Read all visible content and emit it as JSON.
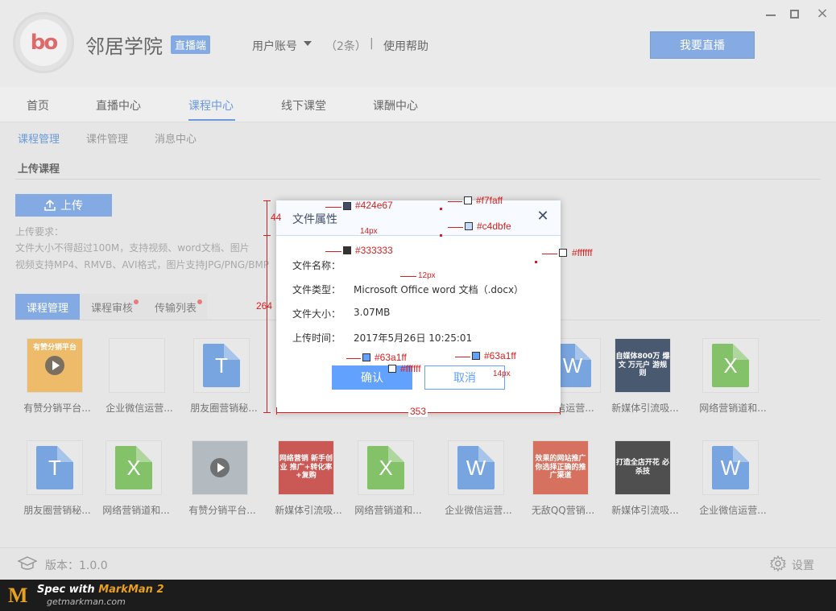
{
  "header": {
    "logo_text": "bo",
    "app_name": "邻居学院",
    "app_badge": "直播端",
    "account_label": "用户账号",
    "message_count": "（2条）",
    "separator": "|",
    "help_label": "使用帮助",
    "live_button": "我要直播",
    "window_controls": [
      "minimize-icon",
      "maximize-icon",
      "close-icon"
    ],
    "close_glyph": "×"
  },
  "main_tabs": [
    "首页",
    "直播中心",
    "课程中心",
    "线下课堂",
    "课酬中心"
  ],
  "main_tabs_active": "课程中心",
  "sub_tabs": [
    "课程管理",
    "课件管理",
    "消息中心"
  ],
  "sub_tabs_active": "课程管理",
  "section_title": "上传课程",
  "upload_button": "上传",
  "requirements": {
    "heading": "上传要求：",
    "line1": "文件大小不得超过100M，支持视频、word文档、图片",
    "line2": "视频支持MP4、RMVB、AVI格式，图片支持JPG/PNG/BMP"
  },
  "course_tabs": [
    "课程管理",
    "课程审核",
    "传输列表"
  ],
  "files_row1": [
    {
      "name": "有赞分销平台...",
      "kind": "video",
      "thumb_text": "有赞分销平台"
    },
    {
      "name": "企业微信运营...",
      "kind": "blank",
      "thumb_text": ""
    },
    {
      "name": "朋友圈营销秘...",
      "kind": "word",
      "thumb_text": "T"
    },
    {
      "name": "",
      "kind": "hidden",
      "thumb_text": ""
    },
    {
      "name": "",
      "kind": "hidden",
      "thumb_text": ""
    },
    {
      "name": "",
      "kind": "hidden",
      "thumb_text": ""
    },
    {
      "name": "信运营...",
      "kind": "word",
      "thumb_text": "W"
    },
    {
      "name": "新媒体引流吸...",
      "kind": "image-dark",
      "thumb_text": "自媒体800万 爆文 万元户 游规则"
    },
    {
      "name": "网络营销道和...",
      "kind": "excel",
      "thumb_text": "X"
    }
  ],
  "files_row2": [
    {
      "name": "朋友圈营销秘...",
      "kind": "word",
      "thumb_text": "T"
    },
    {
      "name": "网络营销道和...",
      "kind": "excel",
      "thumb_text": "X"
    },
    {
      "name": "有赞分销平台...",
      "kind": "video-gray",
      "thumb_text": ""
    },
    {
      "name": "新媒体引流吸...",
      "kind": "image-red",
      "thumb_text": "网络营销 新手创业 推广+转化率+复购"
    },
    {
      "name": "网络营销道和...",
      "kind": "excel",
      "thumb_text": "X"
    },
    {
      "name": "企业微信运营...",
      "kind": "word",
      "thumb_text": "W"
    },
    {
      "name": "无敌QQ营销...",
      "kind": "image-red2",
      "thumb_text": "效果的网站推广 你选择正确的推广渠道"
    },
    {
      "name": "新媒体引流吸...",
      "kind": "image-black",
      "thumb_text": "打造全店开花 必杀技"
    },
    {
      "name": "企业微信运营...",
      "kind": "word",
      "thumb_text": "W"
    }
  ],
  "footer": {
    "version": "版本：1.0.0",
    "settings": "设置"
  },
  "modal": {
    "title": "文件属性",
    "close_glyph": "✕",
    "fields": [
      {
        "label": "文件名称：",
        "value": ""
      },
      {
        "label": "文件类型：",
        "value": "Microsoft Office word 文档（.docx）"
      },
      {
        "label": "文件大小：",
        "value": "3.07MB"
      },
      {
        "label": "上传时间：",
        "value": "2017年5月26日   10:25:01"
      }
    ],
    "confirm": "确认",
    "cancel": "取消"
  },
  "annotations": {
    "header_color": "#424e67",
    "header_bg": "#f7faff",
    "divider_color": "#c4dbfe",
    "text_color": "#333333",
    "modal_bg": "#ffffff",
    "button_color": "#63a1ff",
    "button_text": "#ffffff",
    "cancel_color": "#63a1ff",
    "title_size": "14px",
    "text_size": "12px",
    "button_size": "14px",
    "header_height": "44",
    "modal_height": "264",
    "modal_width": "353"
  },
  "markman": {
    "logo": "M",
    "title_prefix": "Spec with ",
    "title_brand": "MarkMan 2",
    "subtitle": "getmarkman.com"
  }
}
